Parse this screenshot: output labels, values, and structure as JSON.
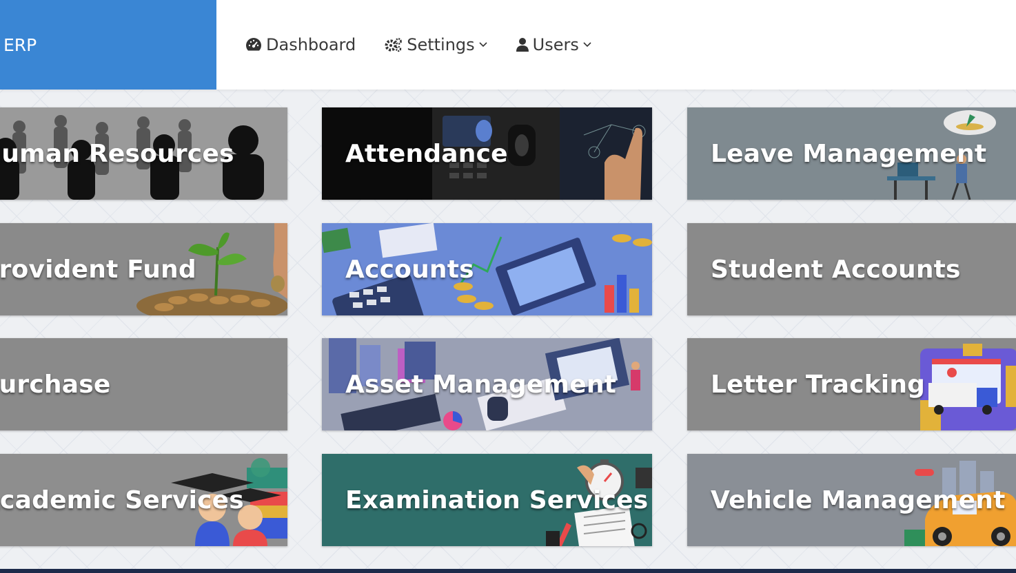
{
  "app": {
    "brand": "ERP"
  },
  "nav": {
    "dashboard": {
      "label": "Dashboard",
      "icon": "tachometer-icon"
    },
    "settings": {
      "label": "Settings",
      "icon": "gears-icon"
    },
    "users": {
      "label": "Users",
      "icon": "user-icon"
    }
  },
  "colors": {
    "brand": "#3a86d4",
    "tile_gray": "#8a8a8a",
    "tile_dark": "#0b0b0b",
    "tile_teal": "#2f6e6a",
    "tile_blue": "#5b7fd0",
    "tile_slate": "#7f8a90",
    "footer": "#1d2a4a"
  },
  "modules": [
    {
      "label": "Human Resources",
      "icon": "people-silhouettes-image"
    },
    {
      "label": "Attendance",
      "icon": "fingerprint-scanner-image"
    },
    {
      "label": "Leave Management",
      "icon": "vacation-image"
    },
    {
      "label": "Provident Fund",
      "icon": "plant-coins-image"
    },
    {
      "label": "Accounts",
      "icon": "calculator-laptop-image"
    },
    {
      "label": "Student Accounts",
      "icon": ""
    },
    {
      "label": "Purchase",
      "icon": ""
    },
    {
      "label": "Asset Management",
      "icon": "isometric-office-image"
    },
    {
      "label": "Letter Tracking",
      "icon": "delivery-truck-image"
    },
    {
      "label": "Academic Services",
      "icon": "graduates-books-image"
    },
    {
      "label": "Examination Services",
      "icon": "stopwatch-exam-image"
    },
    {
      "label": "Vehicle Management",
      "icon": "car-city-image"
    }
  ]
}
